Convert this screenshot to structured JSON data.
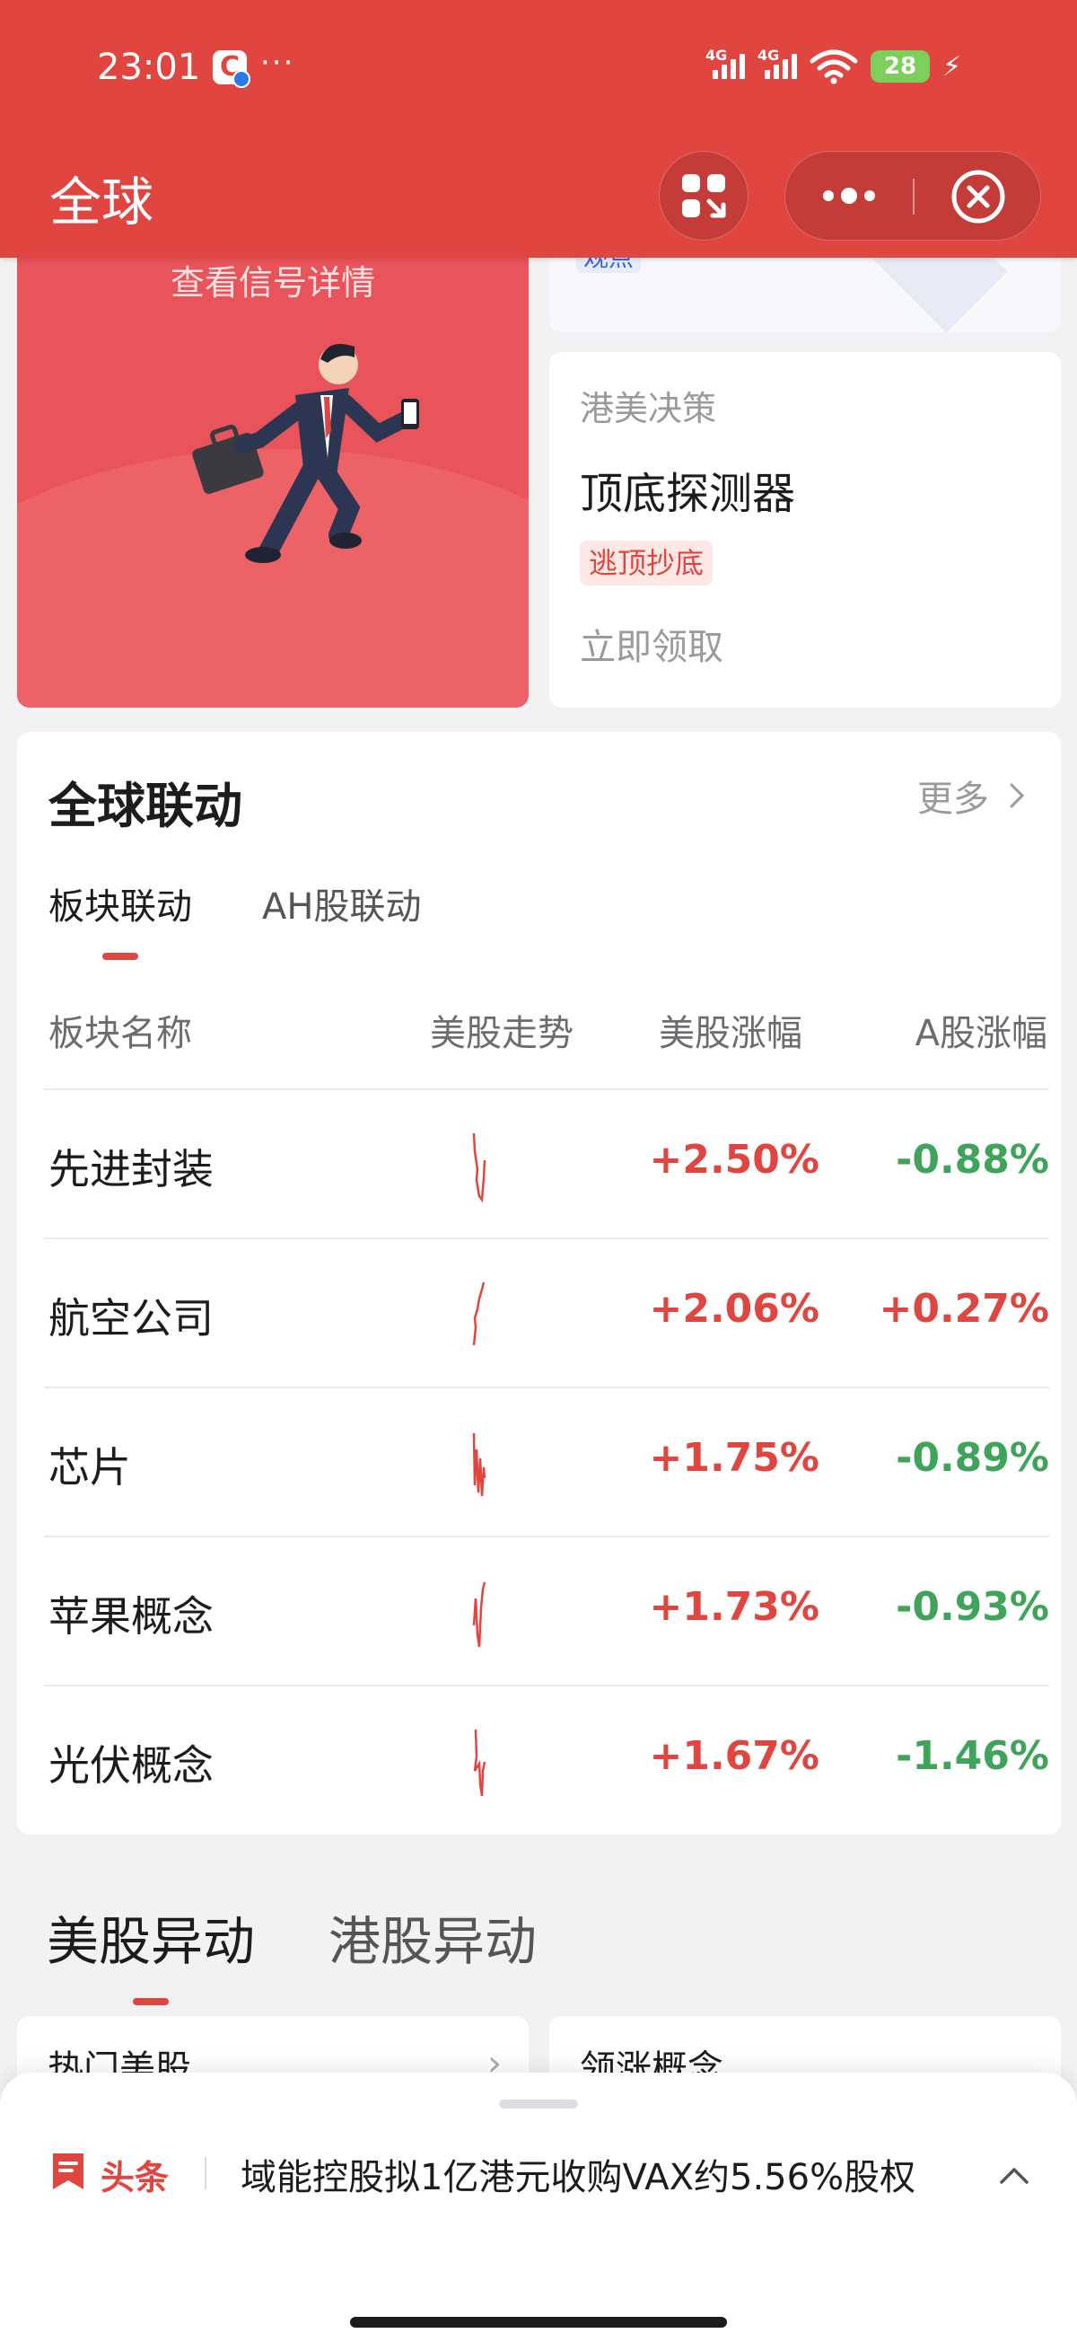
{
  "status_bar": {
    "time": "23:01",
    "app_badge": "C",
    "dots": "···",
    "network_1": "4G",
    "network_2": "4G",
    "battery": "28"
  },
  "header": {
    "title": "全球"
  },
  "promo": {
    "left_cta": "查看信号详情",
    "top_right_tag": "观点",
    "right_source": "港美决策",
    "right_title": "顶底探测器",
    "right_tag": "逃顶抄底",
    "right_cta": "立即领取"
  },
  "linkage": {
    "title": "全球联动",
    "more": "更多",
    "tabs": [
      {
        "label": "板块联动",
        "active": true
      },
      {
        "label": "AH股联动",
        "active": false
      }
    ],
    "columns": {
      "name": "板块名称",
      "trend": "美股走势",
      "us_change": "美股涨幅",
      "a_change": "A股涨幅"
    },
    "rows": [
      {
        "name": "先进封装",
        "us_change": "+2.50%",
        "a_change": "-0.88%",
        "us_dir": "up",
        "a_dir": "down"
      },
      {
        "name": "航空公司",
        "us_change": "+2.06%",
        "a_change": "+0.27%",
        "us_dir": "up",
        "a_dir": "up"
      },
      {
        "name": "芯片",
        "us_change": "+1.75%",
        "a_change": "-0.89%",
        "us_dir": "up",
        "a_dir": "down"
      },
      {
        "name": "苹果概念",
        "us_change": "+1.73%",
        "a_change": "-0.93%",
        "us_dir": "up",
        "a_dir": "down"
      },
      {
        "name": "光伏概念",
        "us_change": "+1.67%",
        "a_change": "-1.46%",
        "us_dir": "up",
        "a_dir": "down"
      }
    ]
  },
  "movers": {
    "tabs": [
      {
        "label": "美股异动",
        "active": true
      },
      {
        "label": "港股异动",
        "active": false
      }
    ],
    "left_card": "热门美股",
    "right_card": "领涨概念"
  },
  "news": {
    "label": "头条",
    "headline": "域能控股拟1亿港元收购VAX约5.56%股权"
  },
  "colors": {
    "brand_red": "#e0453f",
    "up": "#e0453f",
    "down": "#3fa45a"
  }
}
